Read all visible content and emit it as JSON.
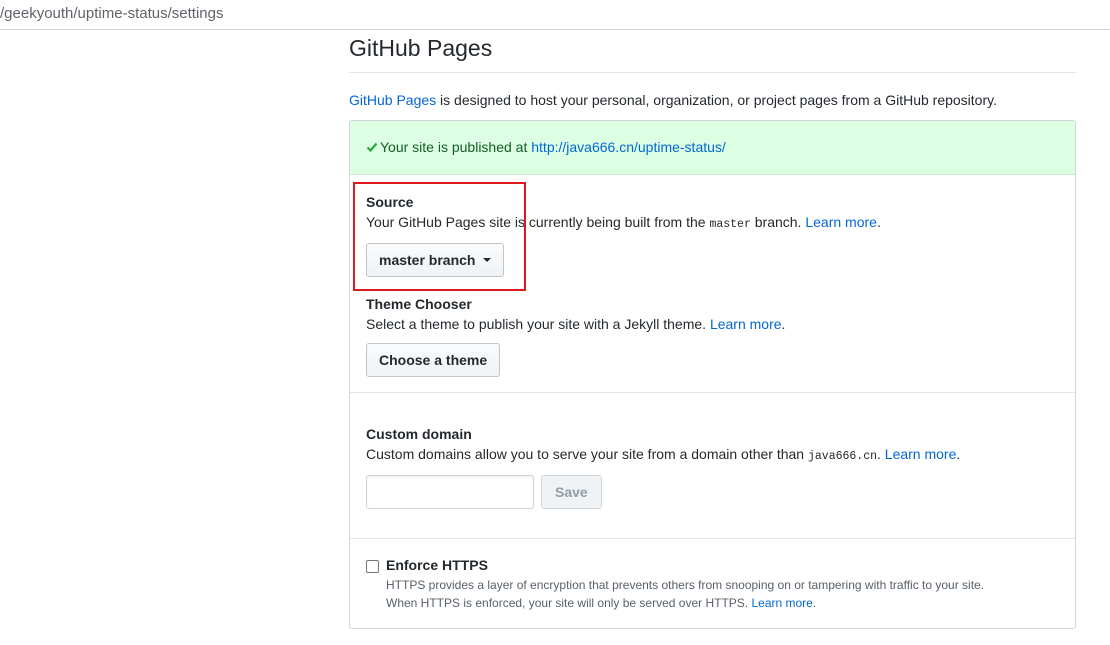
{
  "browser": {
    "url": "/geekyouth/uptime-status/settings"
  },
  "page": {
    "title": "GitHub Pages",
    "intro_link": "GitHub Pages",
    "intro_text": " is designed to host your personal, organization, or project pages from a GitHub repository."
  },
  "flash": {
    "text": "Your site is published at ",
    "url": "http://java666.cn/uptime-status/"
  },
  "source": {
    "heading": "Source",
    "desc_before": "Your GitHub Pages site is currently being built from the ",
    "desc_code": "master",
    "desc_after": " branch. ",
    "learn_more": "Learn more",
    "period": ".",
    "button_label": "master branch"
  },
  "theme": {
    "heading": "Theme Chooser",
    "desc": "Select a theme to publish your site with a Jekyll theme. ",
    "learn_more": "Learn more",
    "period": ".",
    "button_label": "Choose a theme"
  },
  "custom_domain": {
    "heading": "Custom domain",
    "desc_before": "Custom domains allow you to serve your site from a domain other than ",
    "desc_code": "java666.cn",
    "desc_after": ". ",
    "learn_more": "Learn more",
    "period": ".",
    "input_value": "",
    "input_placeholder": "",
    "save_label": "Save"
  },
  "https": {
    "label": "Enforce HTTPS",
    "checked": false,
    "line1": "HTTPS provides a layer of encryption that prevents others from snooping on or tampering with traffic to your site.",
    "line2": "When HTTPS is enforced, your site will only be served over HTTPS. ",
    "learn_more": "Learn more",
    "period": "."
  },
  "colors": {
    "link": "#0366d6",
    "flash_bg": "#dcffe4",
    "highlight": "#e0191e"
  }
}
